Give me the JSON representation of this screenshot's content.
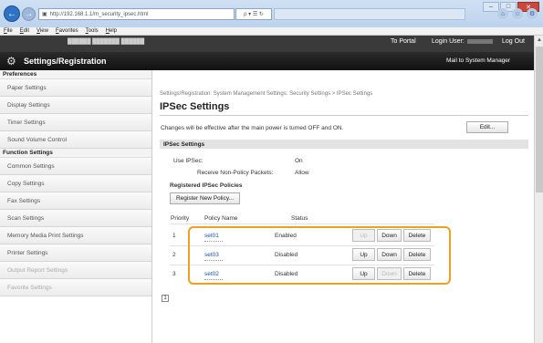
{
  "browser": {
    "address": "http://192.168.1.1/m_security_ipsec.html",
    "address_tools": "ρ ▾ ☰ ↻",
    "menu": [
      "File",
      "Edit",
      "View",
      "Favorites",
      "Tools",
      "Help"
    ],
    "window_controls": [
      "–",
      "□",
      "✕"
    ]
  },
  "header": {
    "to_portal": "To Portal",
    "login_user_label": "Login User:",
    "log_out": "Log Out",
    "title": "Settings/Registration",
    "mail_to": "Mail to System Manager"
  },
  "sidebar": {
    "preferences_title": "Preferences",
    "preferences": [
      "Paper Settings",
      "Display Settings",
      "Timer Settings",
      "Sound Volume Control"
    ],
    "function_title": "Function Settings",
    "functions": [
      "Common Settings",
      "Copy Settings",
      "Fax Settings",
      "Scan Settings",
      "Memory Media Print Settings",
      "Printer Settings",
      "Output Report Settings",
      "Favorite Settings"
    ]
  },
  "main": {
    "breadcrumb": "Settings/Registration: System Management Settings: Security Settings > IPSec Settings",
    "title": "IPSec Settings",
    "notice": "Changes will be effective after the main power is turned OFF and ON.",
    "edit_button": "Edit...",
    "section_title": "IPSec Settings",
    "use_ipsec_label": "Use IPSec:",
    "use_ipsec_value": "On",
    "receive_label": "Receive Non-Policy Packets:",
    "receive_value": "Allow",
    "registered_title": "Registered IPSec Policies",
    "register_button": "Register New Policy...",
    "columns": [
      "Priority",
      "Policy Name",
      "Status"
    ],
    "rows": [
      {
        "priority": "1",
        "name": "set01",
        "status": "Enabled"
      },
      {
        "priority": "2",
        "name": "set03",
        "status": "Disabled"
      },
      {
        "priority": "3",
        "name": "set02",
        "status": "Disabled"
      }
    ],
    "btn_up": "Up",
    "btn_down": "Down",
    "btn_delete": "Delete",
    "page": "1"
  },
  "colors": {
    "header_bg": "#1a1a1a",
    "highlight": "#f0a020",
    "link": "#1a4fb0"
  }
}
